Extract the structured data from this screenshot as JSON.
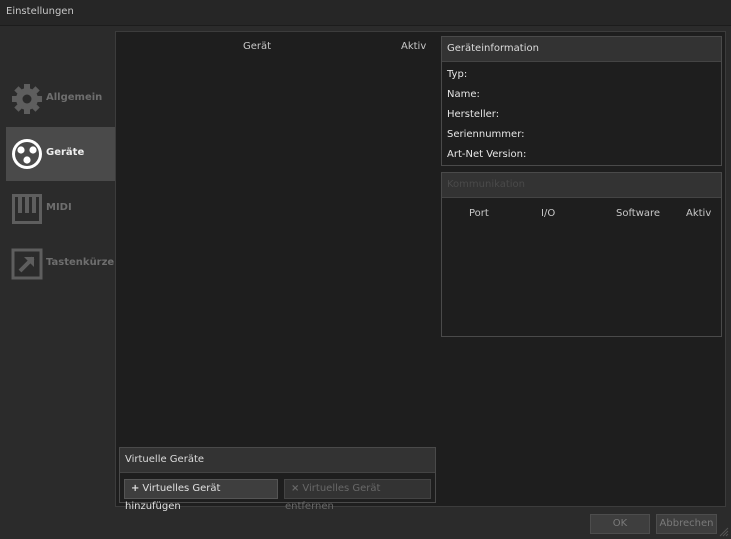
{
  "window": {
    "title": "Einstellungen"
  },
  "sidebar": {
    "items": [
      {
        "label": "Allgemein",
        "icon": "gear-icon",
        "active": false
      },
      {
        "label": "Geräte",
        "icon": "dmx-plug-icon",
        "active": true
      },
      {
        "label": "MIDI",
        "icon": "piano-keys-icon",
        "active": false
      },
      {
        "label": "Tastenkürzel",
        "icon": "shortcut-arrow-icon",
        "active": false
      }
    ]
  },
  "devices": {
    "columns": {
      "device": "Gerät",
      "active": "Aktiv"
    }
  },
  "device_info": {
    "title": "Geräteinformation",
    "fields": [
      {
        "label": "Typ:"
      },
      {
        "label": "Name:"
      },
      {
        "label": "Hersteller:"
      },
      {
        "label": "Seriennummer:"
      },
      {
        "label": "Art-Net Version:"
      }
    ]
  },
  "ports": {
    "title": "Kommunikation",
    "columns": {
      "port": "Port",
      "io": "I/O",
      "software": "Software",
      "active": "Aktiv"
    }
  },
  "virtual_devices": {
    "title": "Virtuelle Geräte",
    "add_label": "Virtuelles Gerät hinzufügen",
    "remove_label": "Virtuelles Gerät entfernen"
  },
  "footer": {
    "ok_label": "OK",
    "cancel_label": "Abbrechen"
  },
  "colors": {
    "background": "#2b2b2b",
    "panel": "#1e1e1e",
    "active_item": "#4a4a4a"
  }
}
